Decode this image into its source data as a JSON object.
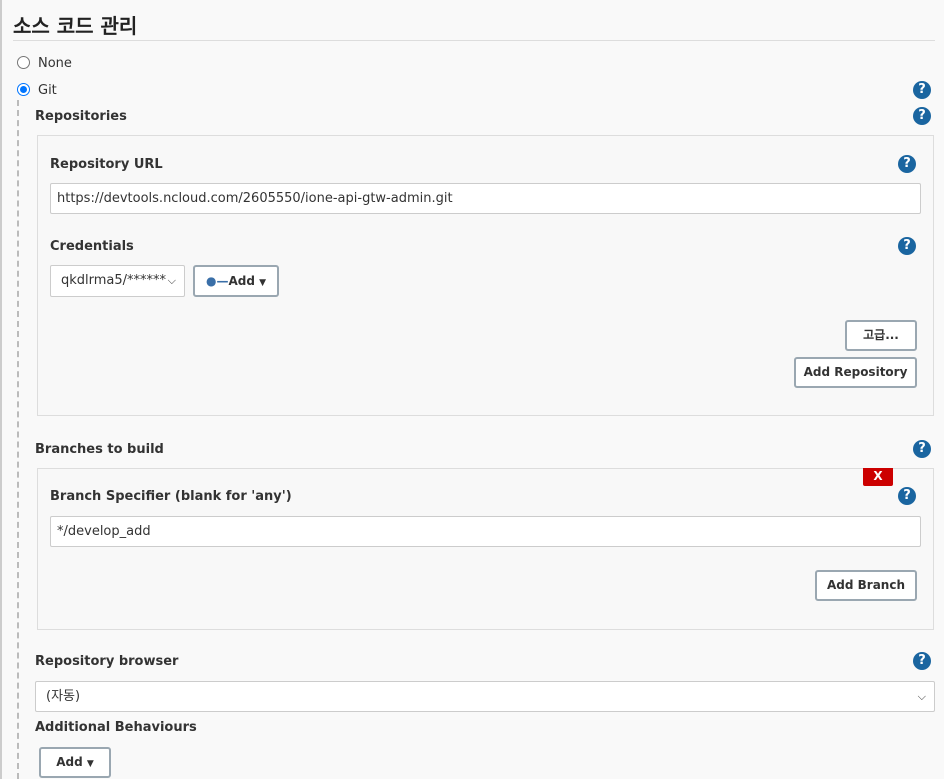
{
  "section_title": "소스 코드 관리",
  "scm_options": [
    {
      "label": "None",
      "selected": false
    },
    {
      "label": "Git",
      "selected": true
    }
  ],
  "repositories": {
    "label": "Repositories",
    "url_label": "Repository URL",
    "url_value": "https://devtools.ncloud.com/2605550/ione-api-gtw-admin.git",
    "credentials_label": "Credentials",
    "credentials_value": "qkdlrma5/******",
    "add_label": "Add",
    "advanced_label": "고급...",
    "add_repository_label": "Add Repository"
  },
  "branches": {
    "label": "Branches to build",
    "delete_label": "X",
    "specifier_label": "Branch Specifier (blank for 'any')",
    "specifier_value": "*/develop_add",
    "add_branch_label": "Add Branch"
  },
  "repo_browser": {
    "label": "Repository browser",
    "value": "(자동)"
  },
  "additional": {
    "label": "Additional Behaviours",
    "add_label": "Add"
  },
  "help_glyph": "?",
  "colors": {
    "help": "#1a65a0",
    "delete": "#cc0000",
    "radio": "#0075ff"
  }
}
